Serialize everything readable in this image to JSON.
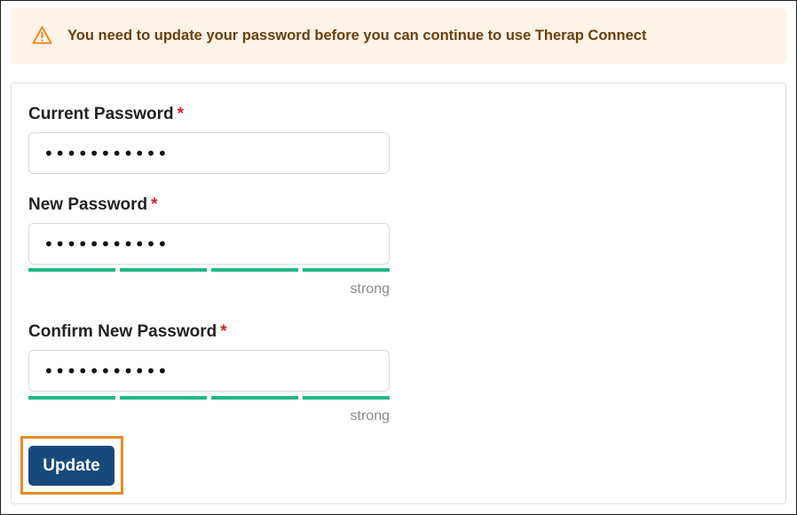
{
  "alert": {
    "icon": "warning-triangle-icon",
    "message": "You need to update your password before you can continue to use Therap Connect",
    "color": "#e98a23"
  },
  "form": {
    "current_password": {
      "label": "Current Password",
      "required_marker": "*",
      "value": "•••••••••••"
    },
    "new_password": {
      "label": "New Password",
      "required_marker": "*",
      "value": "•••••••••••",
      "strength_label": "strong",
      "strength_segments_filled": 4,
      "strength_segments_total": 4
    },
    "confirm_password": {
      "label": "Confirm New Password",
      "required_marker": "*",
      "value": "•••••••••••",
      "strength_label": "strong",
      "strength_segments_filled": 4,
      "strength_segments_total": 4
    },
    "submit_label": "Update"
  },
  "colors": {
    "strength_bar": "#22b783",
    "button_bg": "#174a7c",
    "highlight_outline": "#e98a23",
    "required": "#d3202c"
  }
}
